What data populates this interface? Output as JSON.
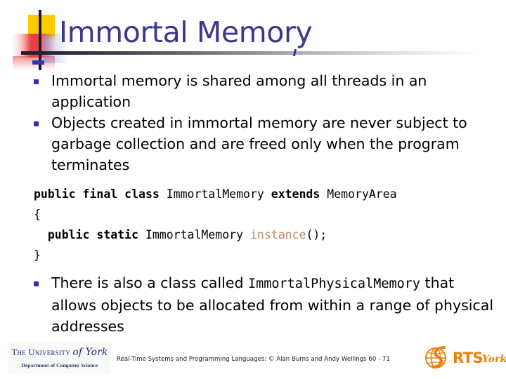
{
  "slide": {
    "title": "Immortal Memory",
    "bullets": [
      {
        "id": "bullet-1",
        "text": "Immortal memory is shared among all threads in an application"
      },
      {
        "id": "bullet-2",
        "text": "Objects created in immortal memory are never subject to garbage collection and are freed only when the program terminates"
      },
      {
        "id": "bullet-3",
        "lead": "There is also a class called ",
        "code": "ImmortalPhysicalMemory",
        "tail": " that allows objects to be allocated from within a range of physical addresses"
      }
    ],
    "code_block": {
      "line1": {
        "kw1": "public final class",
        "space1": " ",
        "type1": "ImmortalMemory",
        "space2": " ",
        "kw2": "extends",
        "space3": " ",
        "type2": "MemoryArea"
      },
      "line2": "{",
      "line3": {
        "kw": "public static",
        "space1": " ",
        "type": "ImmortalMemory",
        "space2": " ",
        "method": "instance",
        "punct": "();"
      },
      "line4": "}"
    }
  },
  "footer": {
    "university_line1_pre": "The University ",
    "university_line1_script": "of York",
    "university_line2": "Department of Computer Science",
    "citation": "Real-Time Systems and Programming Languages: © Alan Burns and Andy Wellings 60 - 71",
    "rts_word": "RTS",
    "rts_york": "York"
  },
  "colors": {
    "title": "#38388c",
    "bullet_marker": "#3333aa",
    "code_method": "#bd8b66",
    "ornament_yellow": "#ffcc00",
    "ornament_red": "#e64040",
    "ornament_dark": "#1a1a2e",
    "rts_orange": "#e8820c",
    "york_navy": "#26267a"
  }
}
